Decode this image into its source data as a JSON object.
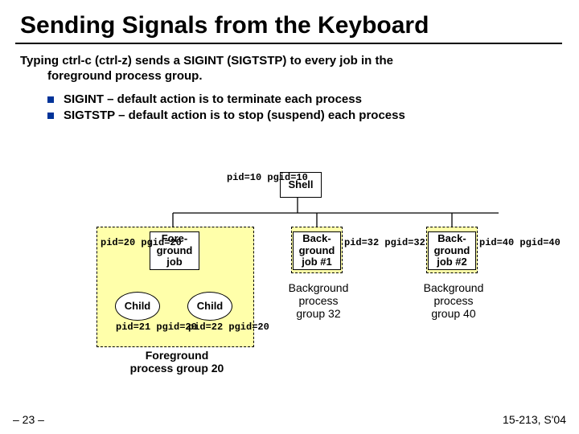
{
  "title": "Sending Signals from the Keyboard",
  "subtitle_line1": "Typing ctrl-c (ctrl-z) sends a SIGINT (SIGTSTP) to every job in the",
  "subtitle_line2": "foreground process group.",
  "bullets": [
    "SIGINT – default action is to terminate each process",
    "SIGTSTP – default action is to stop (suspend) each process"
  ],
  "nodes": {
    "shell": "Shell",
    "fg": "Fore-\nground\njob",
    "bg1": "Back-\nground\njob #1",
    "bg2": "Back-\nground\njob #2",
    "child": "Child"
  },
  "pids": {
    "shell": "pid=10\npgid=10",
    "fg": "pid=20\npgid=20",
    "bg1": "pid=32\npgid=32",
    "bg2": "pid=40\npgid=40",
    "child1": "pid=21\npgid=20",
    "child2": "pid=22\npgid=20"
  },
  "groups": {
    "fg": "Foreground\nprocess group 20",
    "bg32": "Background\nprocess\ngroup 32",
    "bg40": "Background\nprocess\ngroup 40"
  },
  "footer": {
    "left": "– 23 –",
    "right": "15-213, S'04"
  }
}
